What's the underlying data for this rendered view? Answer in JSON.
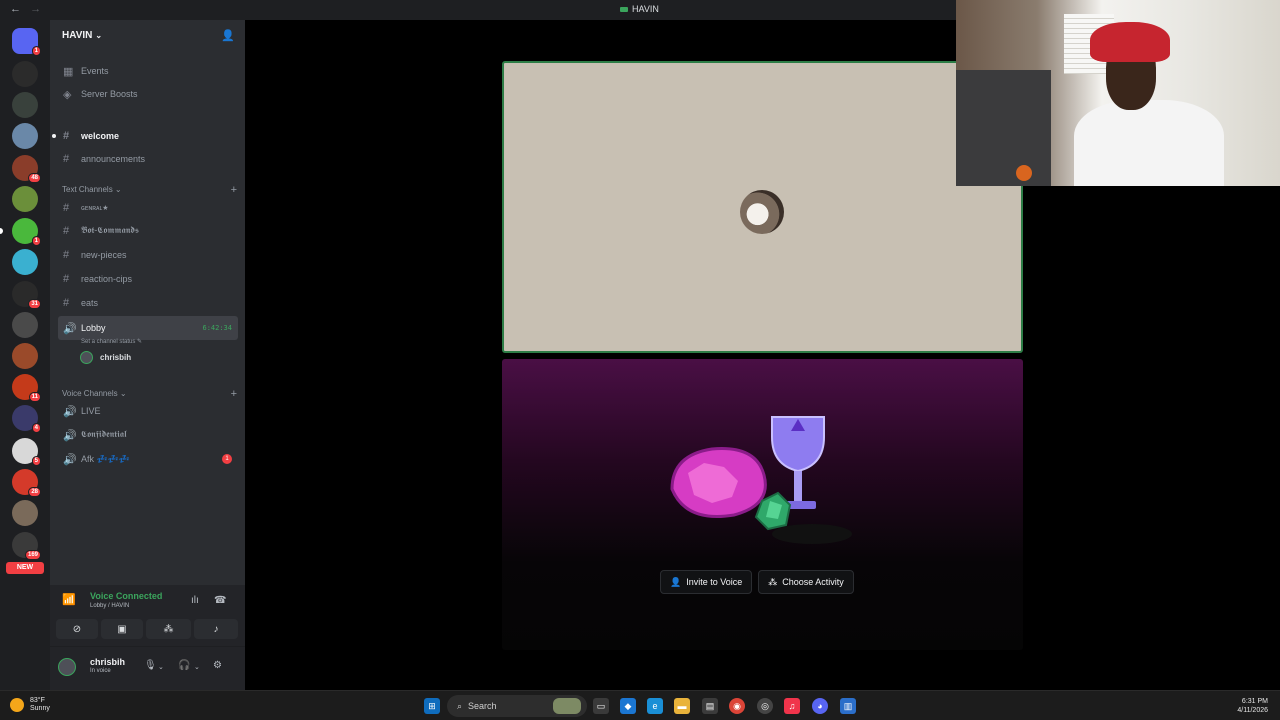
{
  "titlebar": {
    "title": "HAVIN",
    "back": "←",
    "forward": "→"
  },
  "guilds": [
    {
      "name": "discord-home",
      "color": "#5865f2",
      "badge": "1"
    },
    {
      "name": "server-bm",
      "color": "#2b2b2b",
      "badge": ""
    },
    {
      "name": "server-2",
      "color": "#39413c",
      "badge": ""
    },
    {
      "name": "server-3",
      "color": "#6a88a8",
      "badge": ""
    },
    {
      "name": "server-4",
      "color": "#8a3d2a",
      "badge": "48"
    },
    {
      "name": "server-5",
      "color": "#6b8f3a",
      "badge": ""
    },
    {
      "name": "server-havin",
      "color": "#4ab83c",
      "badge": "1"
    },
    {
      "name": "server-7",
      "color": "#3ab0d0",
      "badge": ""
    },
    {
      "name": "server-8",
      "color": "#2a2a2a",
      "badge": "31"
    },
    {
      "name": "server-9",
      "color": "#4a4a4a",
      "badge": ""
    },
    {
      "name": "server-10",
      "color": "#9a4a2a",
      "badge": ""
    },
    {
      "name": "server-11",
      "color": "#c43a1a",
      "badge": "11"
    },
    {
      "name": "server-12",
      "color": "#3a3a6a",
      "badge": "4"
    },
    {
      "name": "server-13",
      "color": "#d8d8d8",
      "badge": "5"
    },
    {
      "name": "server-14",
      "color": "#d43a2a",
      "badge": "28"
    },
    {
      "name": "server-15",
      "color": "#7a6a5a",
      "badge": ""
    },
    {
      "name": "server-16",
      "color": "#3a3a3a",
      "badge": "169"
    }
  ],
  "new_label": "NEW",
  "server": {
    "name": "HAVIN"
  },
  "channels": {
    "events": "Events",
    "boosts": "Server Boosts",
    "welcome": "welcome",
    "announcements": "announcements",
    "text_category": "Text Channels",
    "genral": "ɢᴇɴʀᴀʟ★",
    "bot_commands": "𝕭𝖔𝖙-𝕮𝖔𝖒𝖒𝖆𝖓𝖉𝖘",
    "new_pieces": "new-pieces",
    "reaction_cips": "reaction-cips",
    "eats": "eats",
    "lobby": "Lobby",
    "lobby_timer": "6:42:34",
    "lobby_status": "Set a channel status",
    "voice_user": "chrisbih",
    "voice_category": "Voice Channels",
    "live": "LIVE",
    "confidential": "𝕮𝖔𝖓𝖋𝖎𝖉𝖊𝖓𝖙𝖎𝖆𝖑",
    "afk": "Afk 💤💤💤",
    "afk_count": "1"
  },
  "voice": {
    "title": "Voice Connected",
    "subtitle": "Lobby / HAVIN"
  },
  "user": {
    "name": "chrisbih",
    "status": "In voice"
  },
  "stage": {
    "invite": "Invite to Voice",
    "activity": "Choose Activity"
  },
  "taskbar": {
    "weather_temp": "83°F",
    "weather_desc": "Sunny",
    "search": "Search",
    "time": "6:31 PM",
    "date": "4/11/2026"
  },
  "colors": {
    "accent": "#5865f2",
    "voice_green": "#3ba55d",
    "danger": "#f23f43"
  }
}
